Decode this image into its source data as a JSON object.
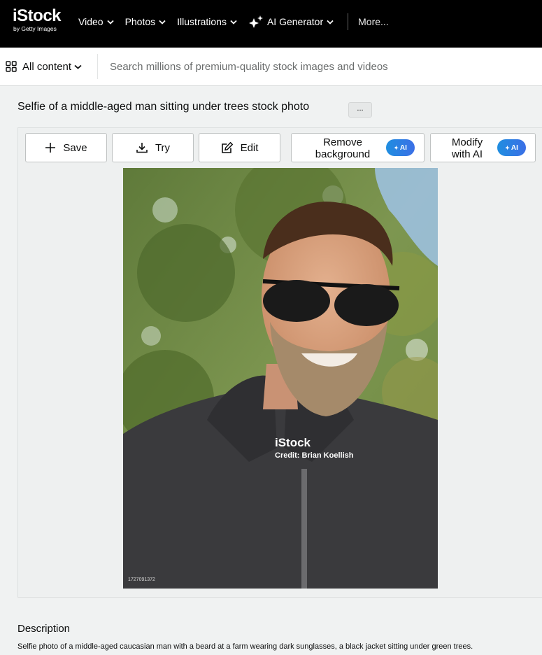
{
  "header": {
    "logo_main": "iStock",
    "logo_sub": "by Getty Images",
    "nav": [
      {
        "label": "Video"
      },
      {
        "label": "Photos"
      },
      {
        "label": "Illustrations"
      },
      {
        "label": "AI Generator"
      }
    ],
    "more_label": "More..."
  },
  "search": {
    "filter_label": "All content",
    "placeholder": "Search millions of premium-quality stock images and videos"
  },
  "page": {
    "title": "Selfie of a middle-aged man sitting under trees stock photo",
    "more_options_label": "..."
  },
  "actions": {
    "save_label": "Save",
    "try_label": "Try",
    "edit_label": "Edit",
    "remove_bg_label_1": "Remove",
    "remove_bg_label_2": "background",
    "modify_label_1": "Modify",
    "modify_label_2": "with AI",
    "ai_badge": "AI"
  },
  "photo": {
    "watermark_brand": "iStock",
    "watermark_credit": "Credit: Brian Koellish",
    "image_id": "1727091372"
  },
  "description": {
    "heading": "Description",
    "text": "Selfie photo of a middle-aged caucasian man with a beard at a farm wearing dark sunglasses, a black jacket sitting under green trees."
  },
  "colors": {
    "topbar_bg": "#000000",
    "ai_gradient_start": "#1f8ee0",
    "ai_gradient_end": "#3b6fe6"
  }
}
